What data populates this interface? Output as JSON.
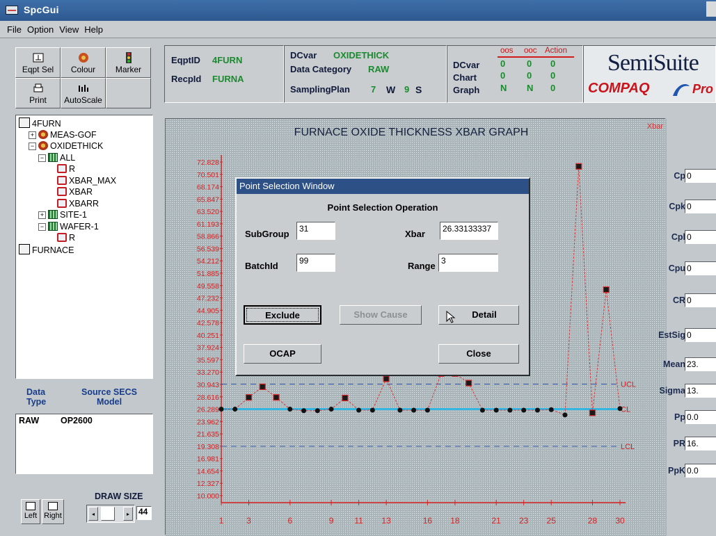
{
  "window": {
    "title": "SpcGui"
  },
  "menu": [
    "File",
    "Option",
    "View",
    "Help"
  ],
  "toolbar": {
    "eqpt_sel": "Eqpt Sel",
    "colour": "Colour",
    "marker": "Marker",
    "print": "Print",
    "autoscale": "AutoScale"
  },
  "tree": [
    {
      "label": "4FURN",
      "icon": "computer-icon",
      "level": 0
    },
    {
      "label": "MEAS-GOF",
      "icon": "flower-icon",
      "level": 1,
      "pm": "+"
    },
    {
      "label": "OXIDETHICK",
      "icon": "flower-icon",
      "level": 1,
      "pm": "-"
    },
    {
      "label": "ALL",
      "icon": "grid-icon",
      "level": 2,
      "pm": "-"
    },
    {
      "label": "R",
      "icon": "face-icon",
      "level": 3
    },
    {
      "label": "XBAR_MAX",
      "icon": "face-icon",
      "level": 3
    },
    {
      "label": "XBAR",
      "icon": "face-icon",
      "level": 3
    },
    {
      "label": "XBARR",
      "icon": "face-icon",
      "level": 3
    },
    {
      "label": "SITE-1",
      "icon": "grid-icon",
      "level": 2,
      "pm": "+"
    },
    {
      "label": "WAFER-1",
      "icon": "grid-icon",
      "level": 2,
      "pm": "-"
    },
    {
      "label": "R",
      "icon": "face-icon",
      "level": 3
    },
    {
      "label": "FURNACE",
      "icon": "computer-icon",
      "level": 0
    }
  ],
  "data_panel": {
    "data_type_label": "Data Type",
    "source_label": "Source SECS Model",
    "type_value": "RAW",
    "model_value": "OP2600"
  },
  "bottom": {
    "left": "Left",
    "right": "Right",
    "draw_size_label": "DRAW SIZE",
    "draw_size_value": "44"
  },
  "header": {
    "eqpt_label": "EqptID",
    "eqpt_value": "4FURN",
    "recp_label": "RecpId",
    "recp_value": "FURNA",
    "dcvar_label": "DCvar",
    "dcvar_value": "OXIDETHICK",
    "datacat_label": "Data Category",
    "datacat_value": "RAW",
    "sampling_label": "SamplingPlan",
    "sampling_n": "7",
    "sampling_w": "W",
    "sampling_n2": "9",
    "sampling_s": "S",
    "status": {
      "cols": [
        "oos",
        "ooc",
        "Action"
      ],
      "rows": [
        {
          "label": "DCvar",
          "values": [
            "0",
            "0",
            "0"
          ]
        },
        {
          "label": "Chart",
          "values": [
            "0",
            "0",
            "0"
          ]
        },
        {
          "label": "Graph",
          "values": [
            "N",
            "N",
            "0"
          ]
        }
      ]
    },
    "brand": "SemiSuite",
    "brand2": "COMPAQ",
    "brand3": "Pro"
  },
  "stats": [
    {
      "label": "Cp",
      "value": "0"
    },
    {
      "label": "Cpk",
      "value": "0"
    },
    {
      "label": "Cpl",
      "value": "0"
    },
    {
      "label": "Cpu",
      "value": "0"
    },
    {
      "label": "CR",
      "value": "0"
    },
    {
      "label": "EstSig",
      "value": "0"
    },
    {
      "label": "Mean",
      "value": "23."
    },
    {
      "label": "Sigma",
      "value": "13."
    },
    {
      "label": "Pp",
      "value": "0.0"
    },
    {
      "label": "PR",
      "value": "16."
    },
    {
      "label": "PpK",
      "value": "0.0"
    }
  ],
  "chart_data": {
    "type": "line",
    "title": "FURNACE OXIDE THICKNESS XBAR GRAPH",
    "series_label": "Xbar",
    "y_ticks": [
      "72.828",
      "70.501",
      "68.174",
      "65.847",
      "63.520",
      "61.193",
      "58.866",
      "56.539",
      "54.212",
      "51.885",
      "49.558",
      "47.232",
      "44.905",
      "42.578",
      "40.251",
      "37.924",
      "35.597",
      "33.270",
      "30.943",
      "28.616",
      "26.289",
      "23.962",
      "21.635",
      "19.308",
      "16.981",
      "14.654",
      "12.327",
      "10.000"
    ],
    "x_ticks": [
      "1",
      "3",
      "6",
      "9",
      "11",
      "13",
      "16",
      "18",
      "21",
      "23",
      "25",
      "28",
      "30"
    ],
    "ylim": [
      10.0,
      72.828
    ],
    "ucl_label": "UCL",
    "cl_label": "CL",
    "lcl_label": "LCL",
    "ucl": 31.0,
    "cl": 26.3,
    "lcl": 19.3,
    "x": [
      1,
      2,
      3,
      4,
      5,
      6,
      7,
      8,
      9,
      10,
      11,
      12,
      13,
      14,
      15,
      16,
      17,
      18,
      19,
      20,
      21,
      22,
      23,
      24,
      25,
      26,
      27,
      28,
      29,
      30
    ],
    "values": [
      26.3,
      26.3,
      28.5,
      30.5,
      28.5,
      26.3,
      26.0,
      26.0,
      26.3,
      28.4,
      26.1,
      26.1,
      32.0,
      26.1,
      26.1,
      26.1,
      33.0,
      33.0,
      31.2,
      26.1,
      26.1,
      26.1,
      26.1,
      26.1,
      26.2,
      25.2,
      72.0,
      25.6,
      48.8,
      26.4
    ]
  },
  "dialog": {
    "title": "Point Selection Window",
    "heading": "Point Selection Operation",
    "subgroup_label": "SubGroup",
    "subgroup_value": "31",
    "xbar_label": "Xbar",
    "xbar_value": "26.33133337",
    "batchid_label": "BatchId",
    "batchid_value": "99",
    "range_label": "Range",
    "range_value": "3",
    "exclude": "Exclude",
    "show_cause": "Show Cause",
    "detail": "Detail",
    "ocap": "OCAP",
    "close": "Close"
  }
}
